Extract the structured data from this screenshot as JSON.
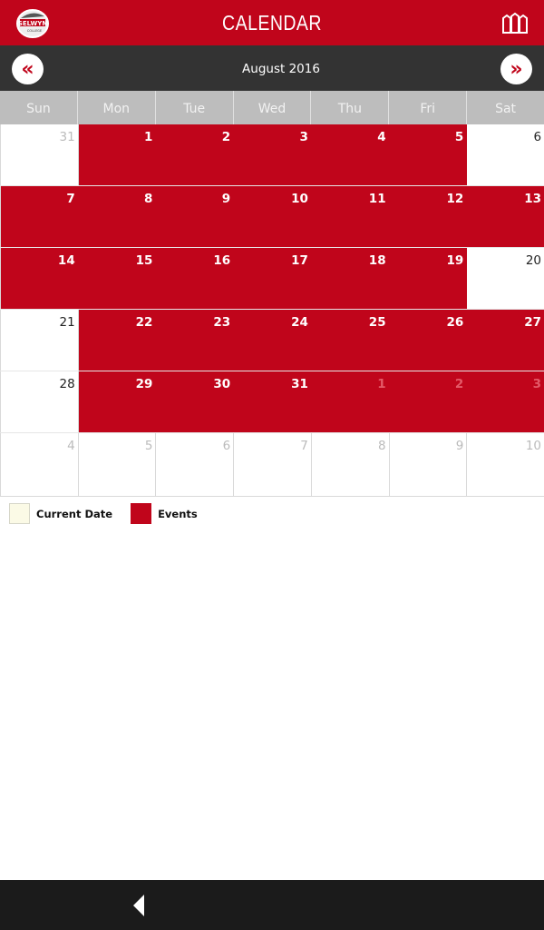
{
  "header": {
    "title": "CALENDAR",
    "logo_icon": "selwyn-college-logo",
    "right_icon": "buildings-icon"
  },
  "nav": {
    "month_label": "August 2016",
    "prev_label": "«",
    "next_label": "»"
  },
  "colors": {
    "brand": "#c0051b",
    "nav_bg": "#333333",
    "current_date": "#fbfae6",
    "events": "#c0051b"
  },
  "weekdays": [
    "Sun",
    "Mon",
    "Tue",
    "Wed",
    "Thu",
    "Fri",
    "Sat"
  ],
  "weeks": [
    [
      {
        "d": "31",
        "t": "other"
      },
      {
        "d": "1",
        "t": "event"
      },
      {
        "d": "2",
        "t": "event"
      },
      {
        "d": "3",
        "t": "event"
      },
      {
        "d": "4",
        "t": "event"
      },
      {
        "d": "5",
        "t": "event"
      },
      {
        "d": "6",
        "t": "cur"
      }
    ],
    [
      {
        "d": "7",
        "t": "event"
      },
      {
        "d": "8",
        "t": "event"
      },
      {
        "d": "9",
        "t": "event"
      },
      {
        "d": "10",
        "t": "event"
      },
      {
        "d": "11",
        "t": "event"
      },
      {
        "d": "12",
        "t": "event"
      },
      {
        "d": "13",
        "t": "event"
      }
    ],
    [
      {
        "d": "14",
        "t": "event"
      },
      {
        "d": "15",
        "t": "event"
      },
      {
        "d": "16",
        "t": "event"
      },
      {
        "d": "17",
        "t": "event"
      },
      {
        "d": "18",
        "t": "event"
      },
      {
        "d": "19",
        "t": "event"
      },
      {
        "d": "20",
        "t": "cur"
      }
    ],
    [
      {
        "d": "21",
        "t": "cur"
      },
      {
        "d": "22",
        "t": "event"
      },
      {
        "d": "23",
        "t": "event"
      },
      {
        "d": "24",
        "t": "event"
      },
      {
        "d": "25",
        "t": "event"
      },
      {
        "d": "26",
        "t": "event"
      },
      {
        "d": "27",
        "t": "event"
      }
    ],
    [
      {
        "d": "28",
        "t": "cur"
      },
      {
        "d": "29",
        "t": "event"
      },
      {
        "d": "30",
        "t": "event"
      },
      {
        "d": "31",
        "t": "event"
      },
      {
        "d": "1",
        "t": "event other"
      },
      {
        "d": "2",
        "t": "event other"
      },
      {
        "d": "3",
        "t": "event other"
      }
    ],
    [
      {
        "d": "4",
        "t": "other"
      },
      {
        "d": "5",
        "t": "other"
      },
      {
        "d": "6",
        "t": "other"
      },
      {
        "d": "7",
        "t": "other"
      },
      {
        "d": "8",
        "t": "other"
      },
      {
        "d": "9",
        "t": "other"
      },
      {
        "d": "10",
        "t": "other"
      }
    ]
  ],
  "legend": {
    "current_date": "Current Date",
    "events": "Events"
  },
  "bottom": {
    "back_icon": "back-triangle-icon"
  }
}
